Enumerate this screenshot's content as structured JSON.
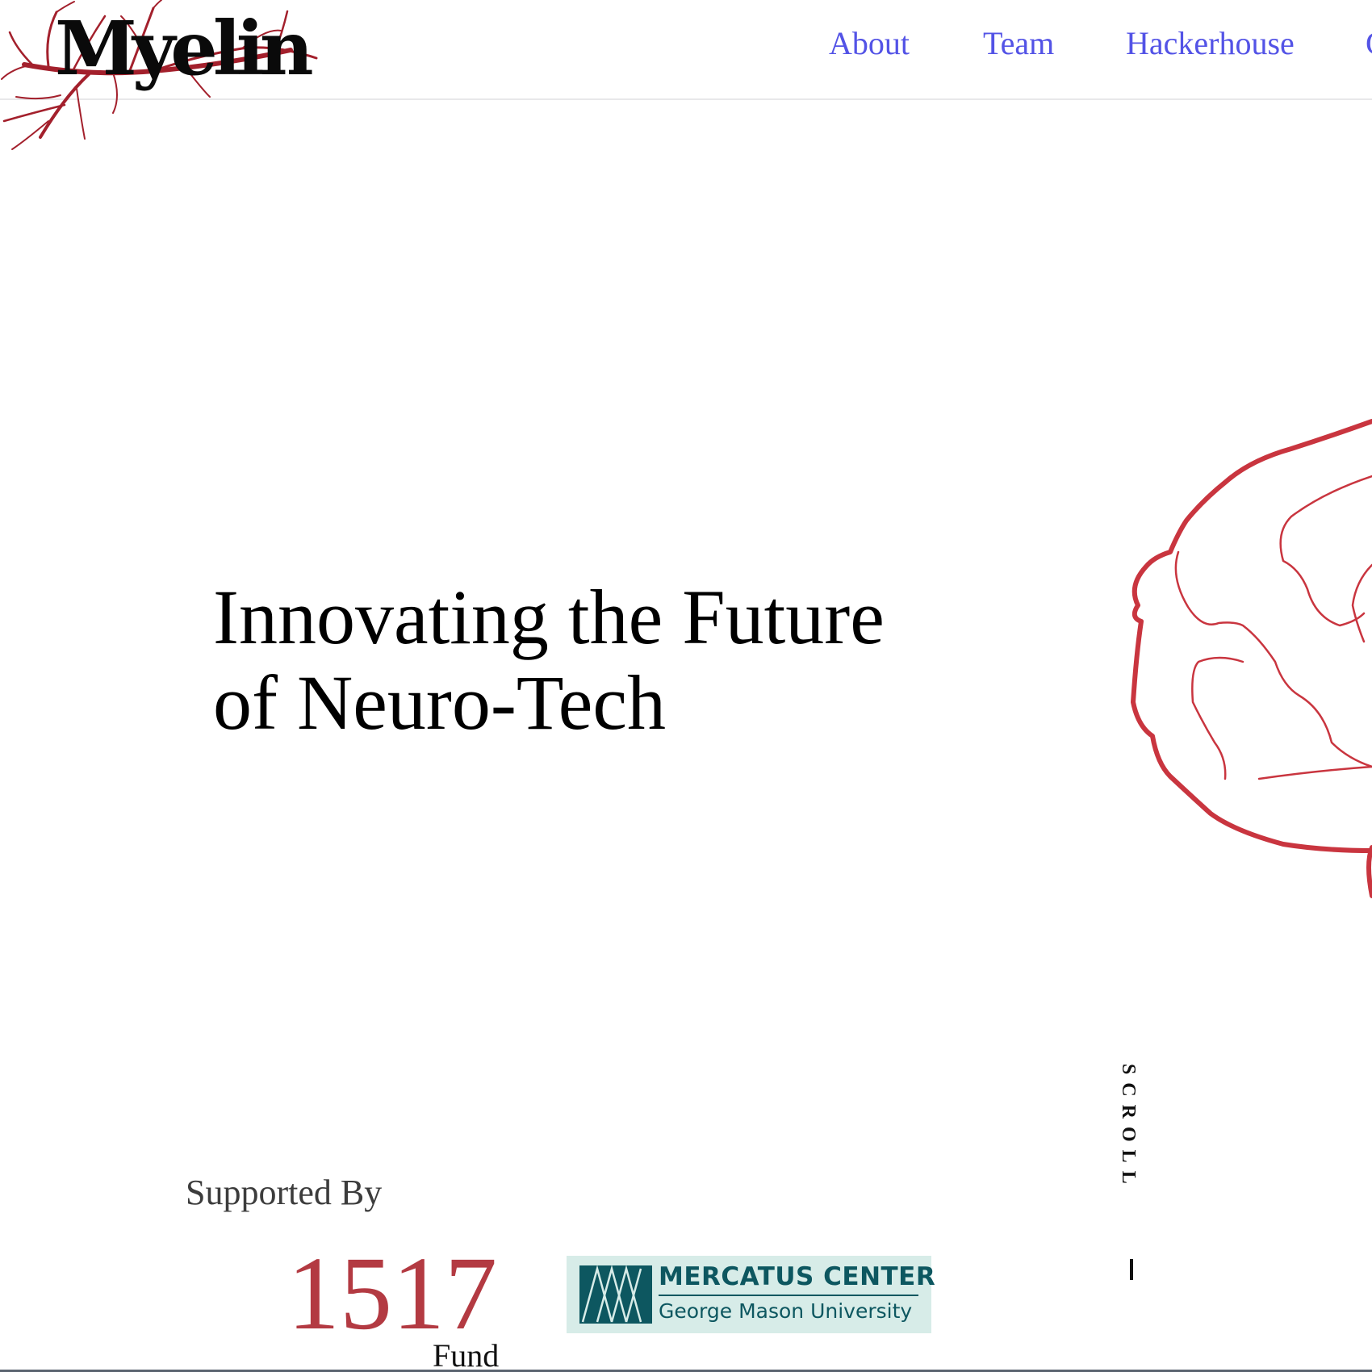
{
  "brand": {
    "name": "Myelin",
    "accent_color": "#b12a35"
  },
  "nav": {
    "items": [
      {
        "label": "About"
      },
      {
        "label": "Team"
      },
      {
        "label": "Hackerhouse"
      },
      {
        "label": "C"
      }
    ],
    "link_color": "#5353e6"
  },
  "hero": {
    "title_line1": "Innovating the Future",
    "title_line2": "of Neuro-Tech",
    "illustration": "brain-outline-icon"
  },
  "scroll": {
    "label": "SCROLL"
  },
  "supporters": {
    "label": "Supported By",
    "fund": {
      "number": "1517",
      "word": "Fund",
      "color": "#b33a42"
    },
    "mercatus": {
      "name": "MERCATUS CENTER",
      "subtitle": "George Mason University",
      "color": "#0d5760",
      "background": "#d7ece8"
    }
  }
}
